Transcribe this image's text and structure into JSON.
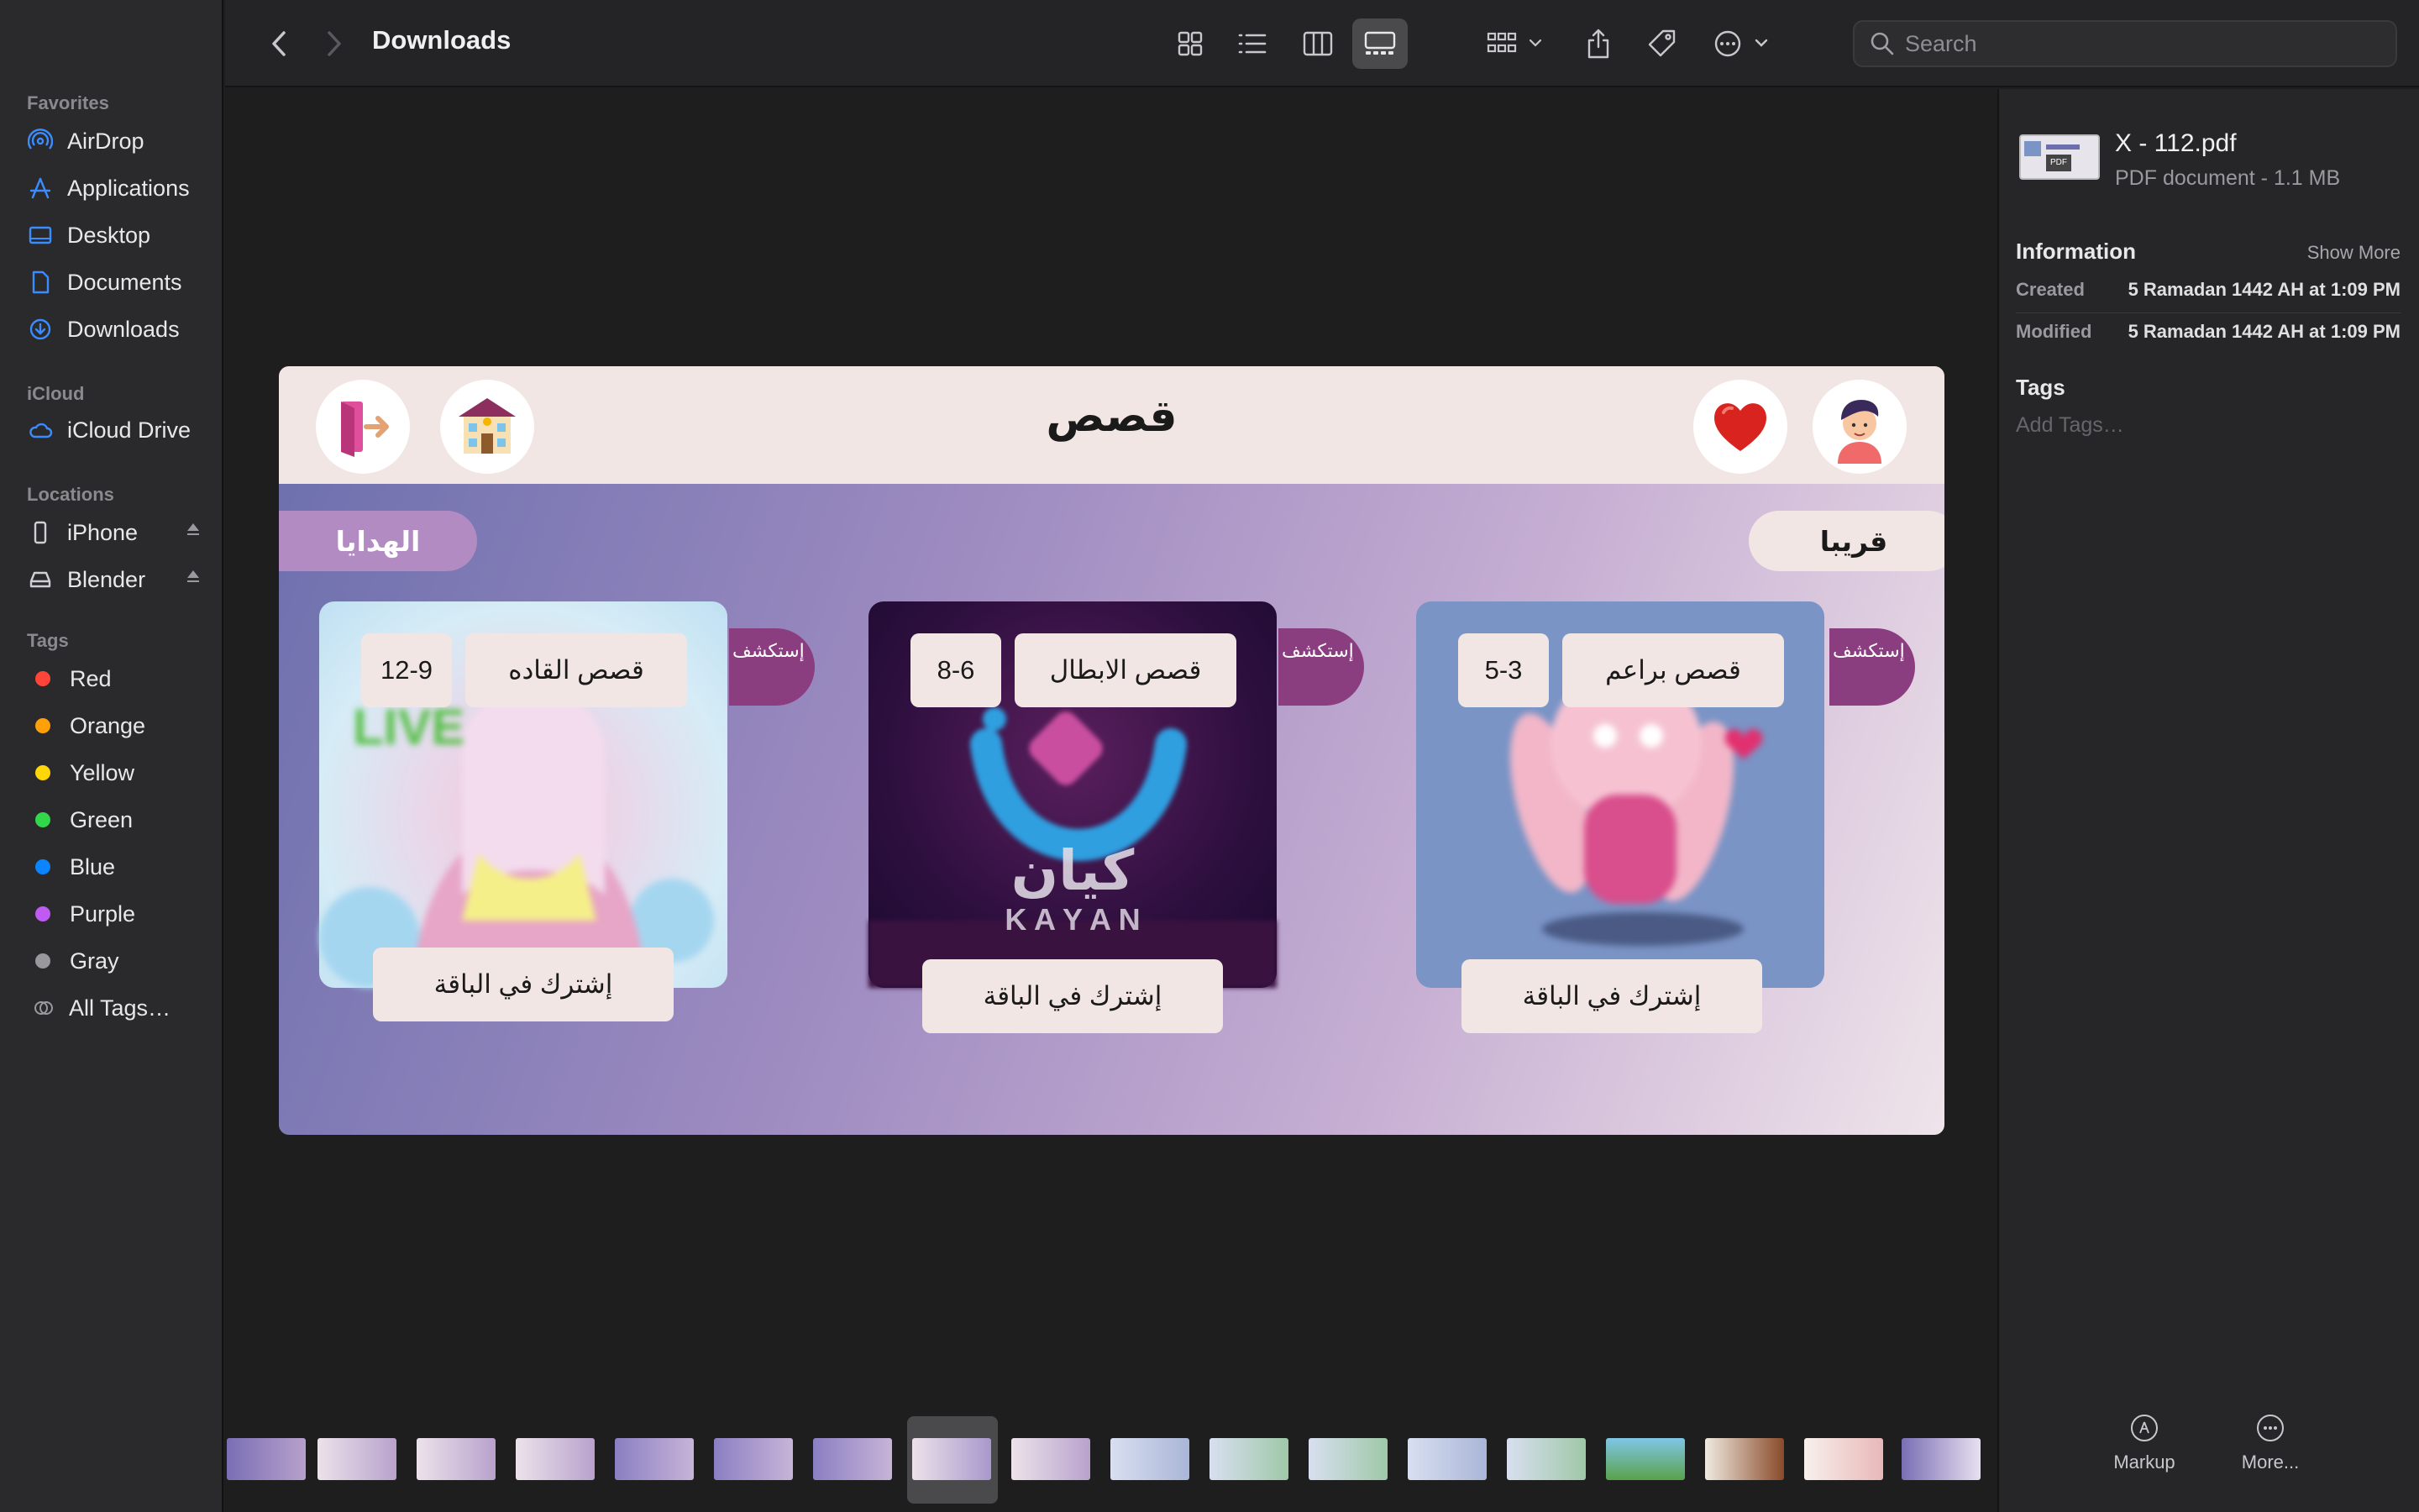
{
  "window": {
    "title": "Downloads"
  },
  "toolbar": {
    "back_icon": "chevron-left-icon",
    "forward_icon": "chevron-right-icon",
    "search_placeholder": "Search"
  },
  "sidebar": {
    "favorites_title": "Favorites",
    "favorites": [
      {
        "label": "AirDrop",
        "icon": "airdrop-icon"
      },
      {
        "label": "Applications",
        "icon": "applications-icon"
      },
      {
        "label": "Desktop",
        "icon": "desktop-icon"
      },
      {
        "label": "Documents",
        "icon": "documents-icon"
      },
      {
        "label": "Downloads",
        "icon": "downloads-icon"
      }
    ],
    "icloud_title": "iCloud",
    "icloud": [
      {
        "label": "iCloud Drive",
        "icon": "cloud-icon"
      }
    ],
    "locations_title": "Locations",
    "locations": [
      {
        "label": "iPhone",
        "icon": "iphone-icon"
      },
      {
        "label": "Blender",
        "icon": "disk-icon"
      }
    ],
    "tags_title": "Tags",
    "tags": [
      {
        "label": "Red",
        "color": "#ff453a"
      },
      {
        "label": "Orange",
        "color": "#ff9f0a"
      },
      {
        "label": "Yellow",
        "color": "#ffd60a"
      },
      {
        "label": "Green",
        "color": "#32d74b"
      },
      {
        "label": "Blue",
        "color": "#0a84ff"
      },
      {
        "label": "Purple",
        "color": "#bf5af2"
      },
      {
        "label": "Gray",
        "color": "#98989d"
      },
      {
        "label": "All Tags…",
        "color": ""
      }
    ]
  },
  "preview": {
    "title": "قصص",
    "left_pill": "الهدايا",
    "right_pill": "قريبا",
    "explore_label": "إستكشف",
    "cards": [
      {
        "name": "قصص القاده",
        "age": "12-9",
        "button": "إشترك في الباقة"
      },
      {
        "name": "قصص الابطال",
        "age": "8-6",
        "button": "إشترك في الباقة",
        "brand_ar": "كيان",
        "brand_en": "K A Y A N"
      },
      {
        "name": "قصص براعم",
        "age": "5-3",
        "button": "إشترك في الباقة"
      }
    ]
  },
  "info": {
    "file_name": "X - 112.pdf",
    "file_type": "PDF document - 1.1 MB",
    "information_title": "Information",
    "show_more": "Show More",
    "created_label": "Created",
    "created_value": "5 Ramadan 1442 AH at 1:09 PM",
    "modified_label": "Modified",
    "modified_value": "5 Ramadan 1442 AH at 1:09 PM",
    "tags_title": "Tags",
    "tags_placeholder": "Add Tags…"
  },
  "footer": {
    "markup_label": "Markup",
    "more_label": "More..."
  }
}
